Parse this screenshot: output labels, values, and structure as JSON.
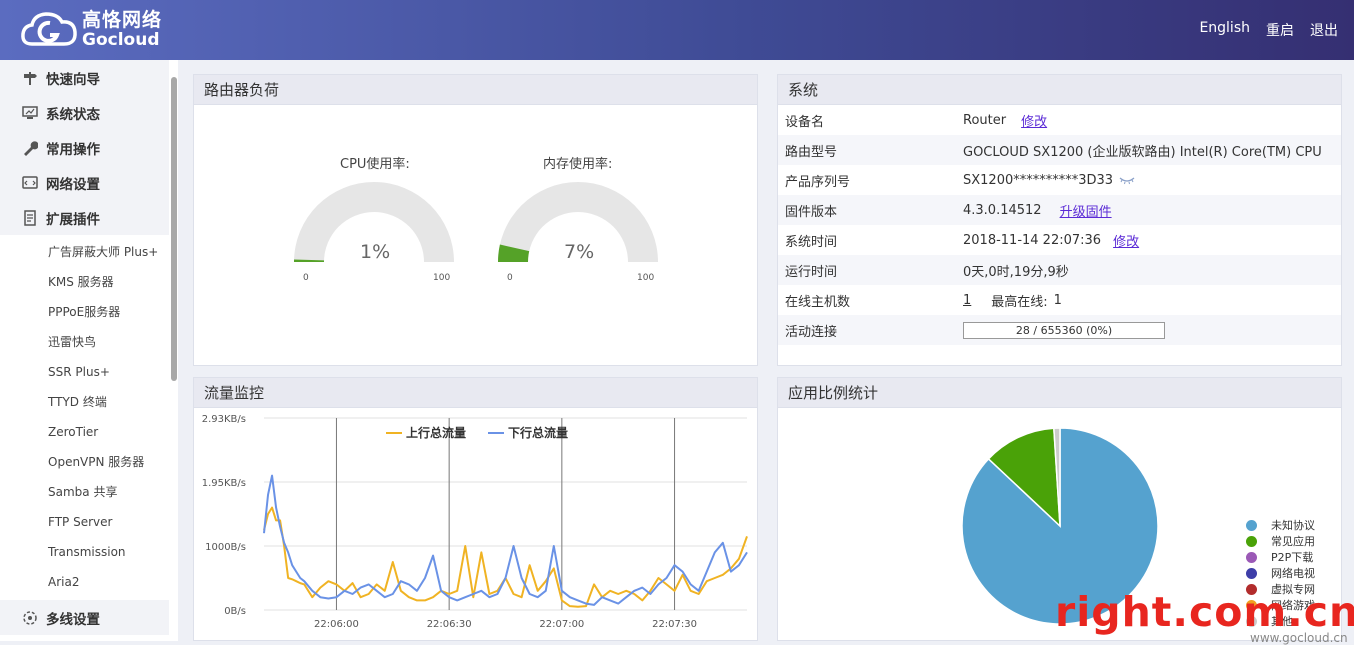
{
  "header": {
    "brand_cn": "高恪网络",
    "brand_en": "Gocloud",
    "nav": [
      "English",
      "重启",
      "退出"
    ]
  },
  "sidebar": {
    "main_items": [
      {
        "label": "快速向导",
        "icon": "signpost-icon"
      },
      {
        "label": "系统状态",
        "icon": "monitor-icon"
      },
      {
        "label": "常用操作",
        "icon": "wrench-icon"
      },
      {
        "label": "网络设置",
        "icon": "network-icon"
      },
      {
        "label": "扩展插件",
        "icon": "plugin-icon"
      }
    ],
    "sub_items": [
      "广告屏蔽大师 Plus+",
      "KMS 服务器",
      "PPPoE服务器",
      "迅雷快鸟",
      "SSR Plus+",
      "TTYD 终端",
      "ZeroTier",
      "OpenVPN 服务器",
      "Samba 共享",
      "FTP Server",
      "Transmission",
      "Aria2"
    ],
    "bottom_item": {
      "label": "多线设置",
      "icon": "multiline-icon"
    }
  },
  "load_panel": {
    "title": "路由器负荷",
    "cpu": {
      "label": "CPU使用率:",
      "value": "1%",
      "percent": 1,
      "min": "0",
      "max": "100"
    },
    "mem": {
      "label": "内存使用率:",
      "value": "7%",
      "percent": 7,
      "min": "0",
      "max": "100"
    }
  },
  "system_panel": {
    "title": "系统",
    "device_name": {
      "key": "设备名",
      "value": "Router",
      "link": "修改"
    },
    "model": {
      "key": "路由型号",
      "value": "GOCLOUD SX1200 (企业版软路由) Intel(R) Core(TM) CPU"
    },
    "serial": {
      "key": "产品序列号",
      "value": "SX1200**********3D33"
    },
    "firmware": {
      "key": "固件版本",
      "value": "4.3.0.14512",
      "link": "升级固件"
    },
    "sys_time": {
      "key": "系统时间",
      "value": "2018-11-14 22:07:36",
      "link": "修改"
    },
    "uptime": {
      "key": "运行时间",
      "value": "0天,0时,19分,9秒"
    },
    "online_hosts": {
      "key": "在线主机数",
      "value": "1",
      "max_label": "最高在线:",
      "max_value": "1"
    },
    "active_conn": {
      "key": "活动连接",
      "value": "28 / 655360 (0%)",
      "percent": 0
    }
  },
  "traffic_panel": {
    "title": "流量监控"
  },
  "app_panel": {
    "title": "应用比例统计"
  },
  "chart_data": [
    {
      "type": "line",
      "title": "",
      "y_ticks": [
        "2.93KB/s",
        "1.95KB/s",
        "1000B/s",
        "0B/s"
      ],
      "x_ticks": [
        "22:06:00",
        "22:06:30",
        "22:07:00",
        "22:07:30"
      ],
      "ylim": [
        0,
        3000
      ],
      "xlim": [
        0,
        120
      ],
      "legend_placement": "top",
      "series": [
        {
          "name": "上行总流量",
          "color": "#f0b323",
          "x": [
            0,
            1,
            2,
            3,
            4,
            5,
            6,
            7,
            8,
            9,
            10,
            12,
            14,
            16,
            18,
            20,
            22,
            24,
            26,
            28,
            30,
            32,
            34,
            36,
            38,
            40,
            42,
            44,
            46,
            48,
            50,
            52,
            54,
            56,
            58,
            60,
            62,
            64,
            66,
            68,
            70,
            72,
            74,
            76,
            78,
            80,
            82,
            84,
            86,
            88,
            90,
            92,
            94,
            96,
            98,
            100,
            102,
            104,
            106,
            108,
            110,
            112,
            114,
            116,
            118,
            120
          ],
          "values": [
            1250,
            1500,
            1600,
            1400,
            1400,
            1000,
            500,
            480,
            450,
            420,
            400,
            200,
            350,
            450,
            400,
            300,
            420,
            200,
            250,
            400,
            300,
            750,
            300,
            200,
            150,
            150,
            200,
            300,
            250,
            300,
            1000,
            200,
            900,
            250,
            300,
            500,
            250,
            200,
            700,
            300,
            450,
            650,
            150,
            60,
            50,
            60,
            400,
            200,
            300,
            250,
            300,
            250,
            150,
            300,
            500,
            400,
            300,
            550,
            300,
            250,
            450,
            500,
            550,
            650,
            800,
            1150
          ]
        },
        {
          "name": "下行总流量",
          "color": "#6a92e6",
          "x": [
            0,
            1,
            2,
            3,
            4,
            5,
            6,
            7,
            8,
            9,
            10,
            12,
            14,
            16,
            18,
            20,
            22,
            24,
            26,
            28,
            30,
            32,
            34,
            36,
            38,
            40,
            42,
            44,
            46,
            48,
            50,
            52,
            54,
            56,
            58,
            60,
            62,
            64,
            66,
            68,
            70,
            72,
            74,
            76,
            78,
            80,
            82,
            84,
            86,
            88,
            90,
            92,
            94,
            96,
            98,
            100,
            102,
            104,
            106,
            108,
            110,
            112,
            114,
            116,
            118,
            120
          ],
          "values": [
            1200,
            1800,
            2100,
            1600,
            1300,
            1050,
            900,
            700,
            600,
            500,
            450,
            300,
            200,
            180,
            200,
            300,
            250,
            350,
            400,
            300,
            200,
            250,
            450,
            400,
            300,
            500,
            850,
            300,
            200,
            150,
            200,
            250,
            300,
            200,
            250,
            500,
            1000,
            500,
            250,
            200,
            300,
            1000,
            300,
            200,
            150,
            100,
            80,
            200,
            150,
            100,
            200,
            300,
            350,
            250,
            400,
            500,
            700,
            600,
            400,
            300,
            600,
            900,
            1050,
            600,
            700,
            900
          ]
        }
      ]
    },
    {
      "type": "pie",
      "title": "",
      "legend_placement": "right",
      "slices": [
        {
          "name": "未知协议",
          "value": 87,
          "color": "#55a2cf"
        },
        {
          "name": "常见应用",
          "value": 12,
          "color": "#4aa208"
        },
        {
          "name": "P2P下载",
          "value": 0,
          "color": "#9b59b6"
        },
        {
          "name": "网络电视",
          "value": 0,
          "color": "#3e3ea8"
        },
        {
          "name": "虚拟专网",
          "value": 0,
          "color": "#b22c2c"
        },
        {
          "name": "网络游戏",
          "value": 0,
          "color": "#f0a020"
        },
        {
          "name": "其他",
          "value": 1,
          "color": "#cccccc"
        }
      ]
    }
  ],
  "watermark": "right.com.cn",
  "footer": "www.gocloud.cn"
}
